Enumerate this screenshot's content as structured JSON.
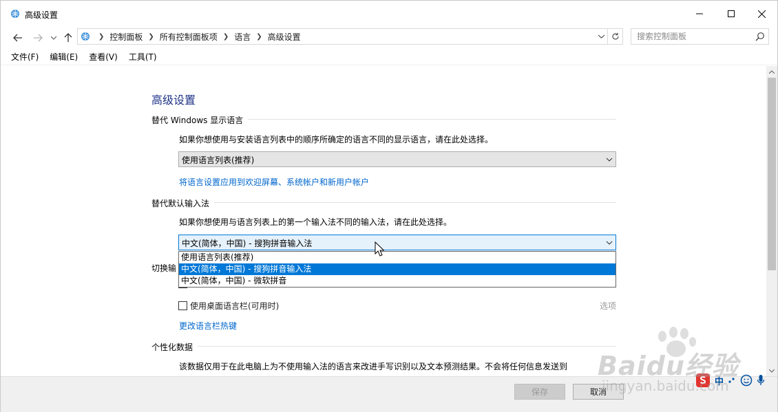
{
  "window": {
    "title": "高级设置"
  },
  "address": {
    "crumbs": [
      "控制面板",
      "所有控制面板项",
      "语言",
      "高级设置"
    ]
  },
  "search": {
    "placeholder": "搜索控制面板"
  },
  "menubar": {
    "items": [
      "文件(F)",
      "编辑(E)",
      "查看(V)",
      "工具(T)"
    ]
  },
  "content": {
    "page_title": "高级设置",
    "display_language": {
      "heading": "替代 Windows 显示语言",
      "description": "如果你想使用与安装语言列表中的顺序所确定的语言不同的显示语言，请在此处选择。",
      "selected": "使用语言列表(推荐)",
      "link": "将语言设置应用到欢迎屏幕、系统帐户和新用户帐户"
    },
    "input_method": {
      "heading": "替代默认输入法",
      "description": "如果你想使用与语言列表上的第一个输入法不同的输入法，请在此处选择。",
      "selected": "中文(简体，中国) - 搜狗拼音输入法",
      "options": [
        "使用语言列表(推荐)",
        "中文(简体，中国) - 搜狗拼音输入法",
        "中文(简体，中国) - 微软拼音"
      ],
      "selected_index": 1
    },
    "switch_input": {
      "heading_partial": "切换输",
      "desktop_bar_label": "使用桌面语言栏(可用时)",
      "desktop_bar_checked": false,
      "options_label": "选项",
      "hotkey_link": "更改语言栏热键"
    },
    "personalization": {
      "heading": "个性化数据",
      "description": "该数据仅用于在此电脑上为不使用输入法的语言来改进手写识别以及文本预测结果。不会将任何信息发送到"
    }
  },
  "footer": {
    "save_label": "保存",
    "cancel_label": "取消"
  },
  "tray": {
    "ime_mode": "中"
  },
  "watermark": {
    "brand": "Baidu经验",
    "url": "jingyan.baidu.com"
  },
  "colors": {
    "accent": "#0078d7",
    "link": "#0066cc",
    "title": "#1e3287"
  }
}
